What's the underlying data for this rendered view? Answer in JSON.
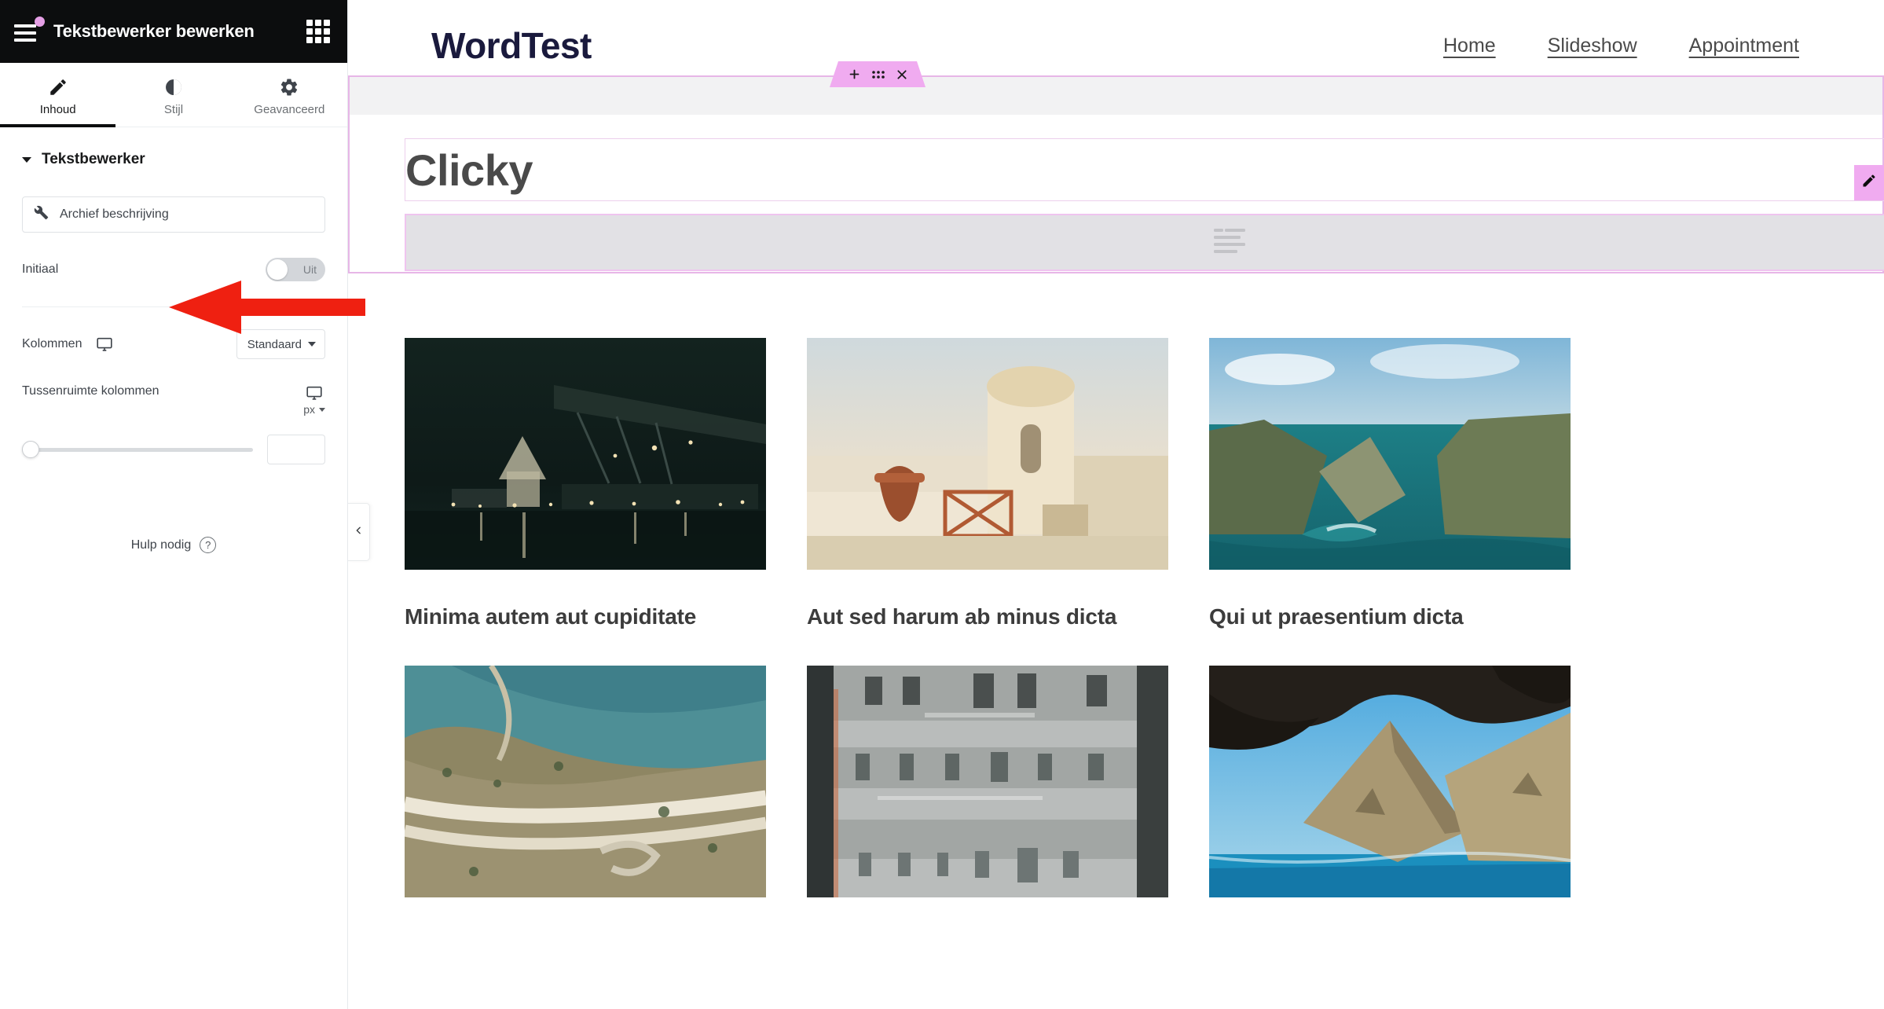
{
  "panel": {
    "header": {
      "title": "Tekstbewerker bewerken",
      "menu_icon": "hamburger-icon",
      "apps_icon": "grid-apps-icon"
    },
    "tabs": [
      {
        "label": "Inhoud",
        "icon": "pencil-icon",
        "active": true
      },
      {
        "label": "Stijl",
        "icon": "contrast-circle-icon",
        "active": false
      },
      {
        "label": "Geavanceerd",
        "icon": "gear-icon",
        "active": false
      }
    ],
    "section": {
      "title": "Tekstbewerker"
    },
    "controls": {
      "dynamic_tag": {
        "label": "Archief beschrijving",
        "icon": "wrench-icon"
      },
      "initial": {
        "label": "Initiaal",
        "state": "Uit",
        "enabled": false
      },
      "columns": {
        "label": "Kolommen",
        "value": "Standaard",
        "device_icon": "desktop-icon"
      },
      "column_gap": {
        "label": "Tussenruimte kolommen",
        "device_icon": "desktop-icon",
        "unit": "px",
        "slider_value": 0,
        "number_value": "",
        "number_placeholder": ""
      }
    },
    "help": {
      "label": "Hulp nodig",
      "icon": "question-circle-icon"
    },
    "collapse": {
      "icon": "chevron-left-icon"
    }
  },
  "preview": {
    "site": {
      "brand": "WordTest",
      "nav": [
        {
          "label": "Home"
        },
        {
          "label": "Slideshow"
        },
        {
          "label": "Appointment"
        }
      ]
    },
    "section_toolbar": {
      "add": {
        "icon": "plus-icon",
        "label": "+"
      },
      "drag": {
        "icon": "drag-dots-icon"
      },
      "close": {
        "icon": "close-x-icon"
      }
    },
    "heading_widget": {
      "text": "Clicky"
    },
    "edit_pill": {
      "icon": "pencil-edit-icon"
    },
    "text_widget": {
      "placeholder_icon": "text-lines-icon",
      "text": ""
    },
    "posts": [
      {
        "title": "Minima autem aut cupiditate",
        "image": "night-city-bridge"
      },
      {
        "title": "Aut sed harum ab minus dicta",
        "image": "mediterranean-village"
      },
      {
        "title": "Qui ut praesentium dicta",
        "image": "coastal-cliffs"
      },
      {
        "title": "",
        "image": "aerial-highway"
      },
      {
        "title": "",
        "image": "concrete-facade"
      },
      {
        "title": "",
        "image": "sea-cave-arch"
      }
    ]
  },
  "annotation": {
    "type": "arrow",
    "color": "#ef2011",
    "points_to": "Archief beschrijving"
  },
  "colors": {
    "panel_header_bg": "#0c0d0e",
    "accent_pink": "#f0abf0",
    "brand_navy": "#1a1a3d",
    "annotation_red": "#ef2011",
    "toggle_off": "#d3d6da"
  }
}
